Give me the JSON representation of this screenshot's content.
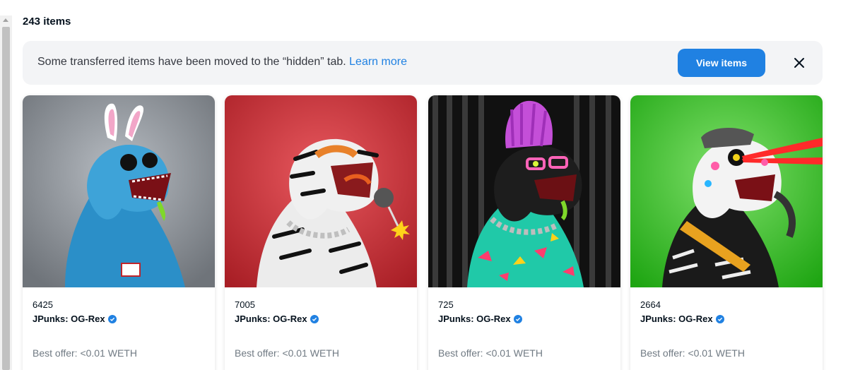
{
  "header": {
    "count_text": "243 items"
  },
  "notice": {
    "message": "Some transferred items have been moved to the “hidden” tab.",
    "link_label": "Learn more",
    "button_label": "View items",
    "close_icon": "close-icon"
  },
  "cards": [
    {
      "token_id": "6425",
      "collection": "JPunks: OG-Rex",
      "offer": "Best offer: <0.01 WETH",
      "background": "#8e9399",
      "accent": "#3ea3d8"
    },
    {
      "token_id": "7005",
      "collection": "JPunks: OG-Rex",
      "offer": "Best offer: <0.01 WETH",
      "background": "#c22a31",
      "accent": "#e8e8e8"
    },
    {
      "token_id": "725",
      "collection": "JPunks: OG-Rex",
      "offer": "Best offer: <0.01 WETH",
      "background": "#151515",
      "accent": "#22c7a9"
    },
    {
      "token_id": "2664",
      "collection": "JPunks: OG-Rex",
      "offer": "Best offer: <0.01 WETH",
      "background": "#27b418",
      "accent": "#f1f1f1"
    }
  ],
  "colors": {
    "accent": "#2081e2",
    "notice_bg": "#f3f4f6",
    "verified": "#2081e2"
  }
}
